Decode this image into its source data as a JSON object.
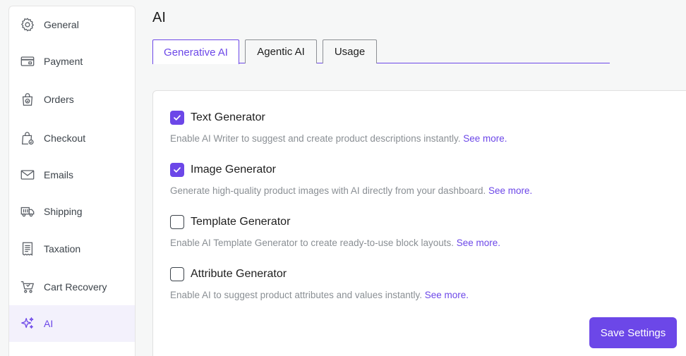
{
  "sidebar": {
    "items": [
      {
        "label": "General",
        "icon": "gear-icon"
      },
      {
        "label": "Payment",
        "icon": "credit-card-icon"
      },
      {
        "label": "Orders",
        "icon": "shopping-bag-icon"
      },
      {
        "label": "Checkout",
        "icon": "checkout-bag-icon"
      },
      {
        "label": "Emails",
        "icon": "envelope-icon"
      },
      {
        "label": "Shipping",
        "icon": "truck-icon"
      },
      {
        "label": "Taxation",
        "icon": "receipt-icon"
      },
      {
        "label": "Cart Recovery",
        "icon": "cart-icon"
      },
      {
        "label": "AI",
        "icon": "sparkles-icon"
      }
    ],
    "active": "AI"
  },
  "page": {
    "title": "AI"
  },
  "tabs": [
    {
      "label": "Generative AI",
      "active": true
    },
    {
      "label": "Agentic AI",
      "active": false
    },
    {
      "label": "Usage",
      "active": false
    }
  ],
  "options": [
    {
      "title": "Text Generator",
      "checked": true,
      "desc": "Enable AI Writer to suggest and create product descriptions instantly.",
      "link": "See more."
    },
    {
      "title": "Image Generator",
      "checked": true,
      "desc": "Generate high-quality product images with AI directly from your dashboard.",
      "link": "See more."
    },
    {
      "title": "Template Generator",
      "checked": false,
      "desc": "Enable AI Template Generator to create ready-to-use block layouts.",
      "link": "See more."
    },
    {
      "title": "Attribute Generator",
      "checked": false,
      "desc": "Enable AI to suggest product attributes and values instantly.",
      "link": "See more."
    }
  ],
  "actions": {
    "save_label": "Save Settings"
  },
  "colors": {
    "accent": "#6c47e8",
    "active_bg": "#f3f1fc",
    "muted_text": "#8a8f94"
  }
}
